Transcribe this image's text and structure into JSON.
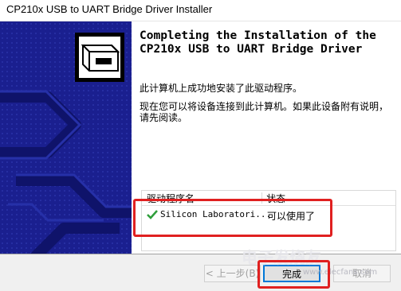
{
  "window": {
    "title": "CP210x USB to UART Bridge Driver Installer"
  },
  "heading": "Completing the Installation of the CP210x USB to UART Bridge Driver",
  "body": {
    "line1": "此计算机上成功地安装了此驱动程序。",
    "line2": "现在您可以将设备连接到此计算机。如果此设备附有说明，请先阅读。"
  },
  "table": {
    "col_driver": "驱动程序名",
    "col_status": "状态",
    "rows": [
      {
        "name": "Silicon Laboratori...",
        "status": "可以使用了"
      }
    ]
  },
  "buttons": {
    "back": "< 上一步(B)",
    "finish": "完成",
    "cancel": "取消"
  },
  "watermark": {
    "text": "电子发烧友",
    "url": "www.elecfans.com"
  },
  "colors": {
    "banner": "#1a1f8f",
    "highlight": "#e02020",
    "check": "#2e9e3a"
  }
}
